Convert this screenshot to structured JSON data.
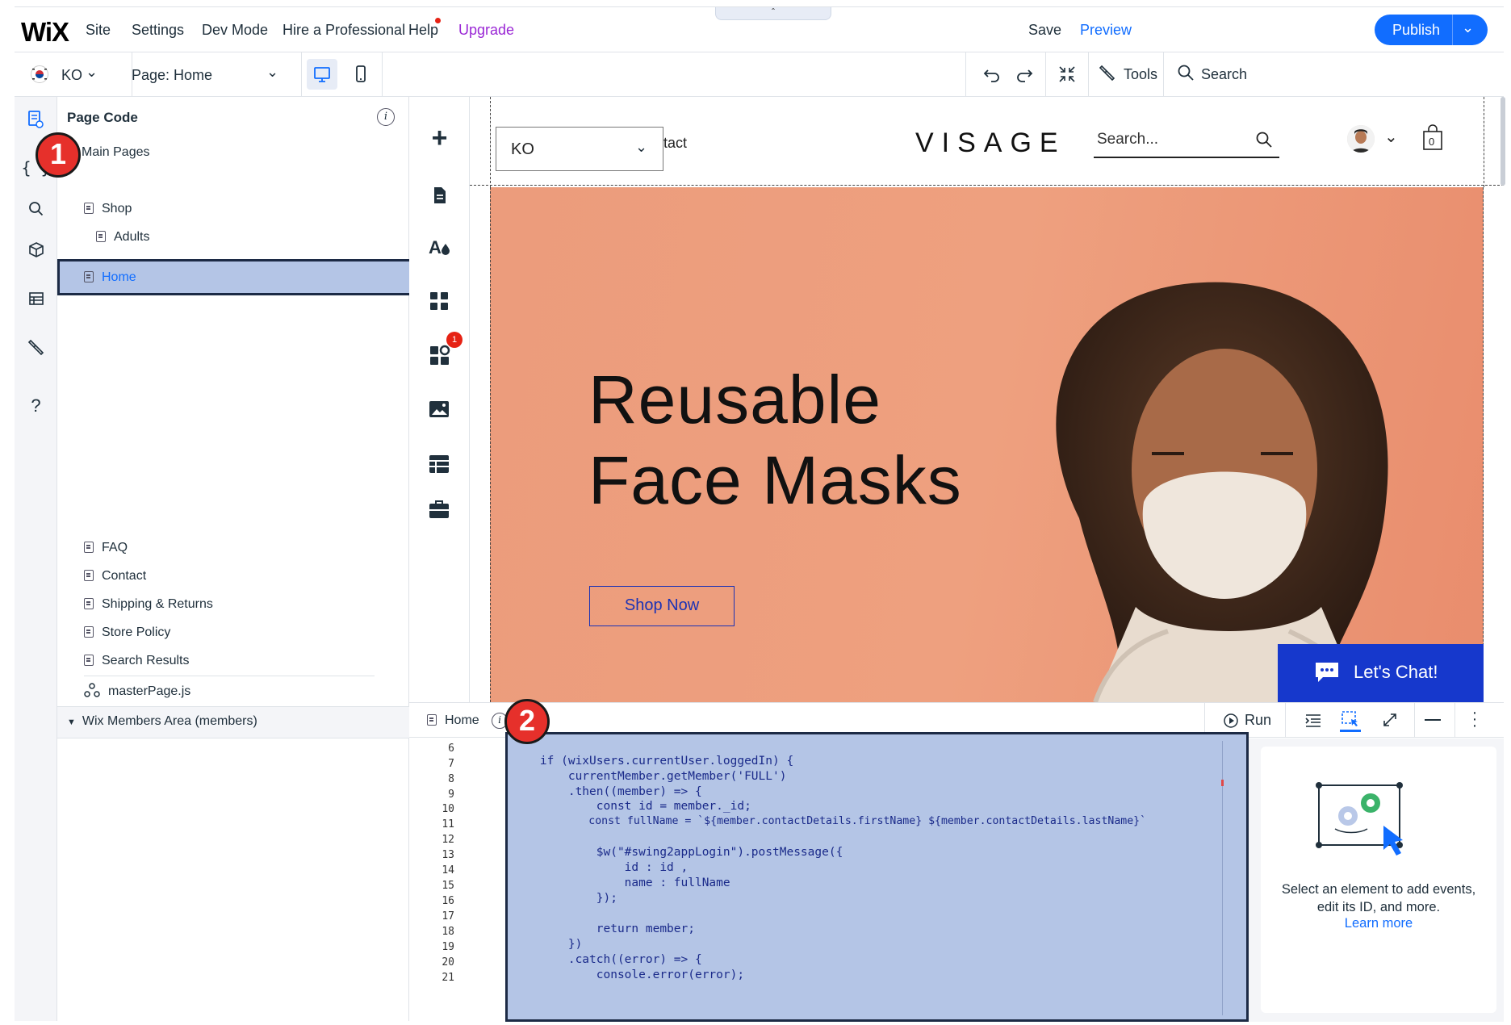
{
  "topbar": {
    "logo": "WiX",
    "menu": [
      "Site",
      "Settings",
      "Dev Mode",
      "Hire a Professional",
      "Help",
      "Upgrade"
    ],
    "save": "Save",
    "preview": "Preview",
    "publish": "Publish"
  },
  "toolbar": {
    "language": "KO",
    "page_selector": "Page: Home",
    "tools": "Tools",
    "search": "Search"
  },
  "page_code": {
    "title": "Page Code",
    "main_pages_label": "Main Pages",
    "pages": [
      "Home",
      "Shop",
      "Adults"
    ],
    "more_pages": [
      "FAQ",
      "Contact",
      "Shipping & Returns",
      "Store Policy",
      "Search Results"
    ],
    "master_page": "masterPage.js",
    "members_area": "Wix Members Area (members)"
  },
  "add_panel": {
    "notification_count": "1"
  },
  "site": {
    "language_dropdown": "KO",
    "nav_partial": "tact",
    "brand": "VISAGE",
    "search_placeholder": "Search...",
    "cart_count": "0",
    "hero_title_line1": "Reusable",
    "hero_title_line2": "Face Masks",
    "cta": "Shop Now",
    "chat": "Let's Chat!"
  },
  "code_editor": {
    "tab": "Home",
    "run": "Run",
    "line_numbers": [
      "6",
      "7",
      "8",
      "9",
      "10",
      "11",
      "12",
      "13",
      "14",
      "15",
      "16",
      "17",
      "18",
      "19",
      "20",
      "21"
    ],
    "lines": [
      "",
      "    if (wixUsers.currentUser.loggedIn) {",
      "        currentMember.getMember('FULL')",
      "        .then((member) => {",
      "            const id = member._id;",
      "            const fullName = `${member.contactDetails.firstName} ${member.contactDetails.lastName}`",
      "",
      "            $w(\"#swing2appLogin\").postMessage({",
      "                id : id ,",
      "                name : fullName",
      "            });",
      "",
      "            return member;",
      "        })",
      "        .catch((error) => {",
      "            console.error(error);"
    ]
  },
  "properties": {
    "hint": "Select an element to add events, edit its ID, and more.",
    "learn_more": "Learn more"
  },
  "annotations": [
    "1",
    "2"
  ],
  "colors": {
    "accent": "#116dff",
    "highlight": "#b4c5e6",
    "hero_bg": "#ec9c7c",
    "chat_bg": "#1638cc",
    "badge": "#e6302b",
    "upgrade": "#9a27d5"
  }
}
